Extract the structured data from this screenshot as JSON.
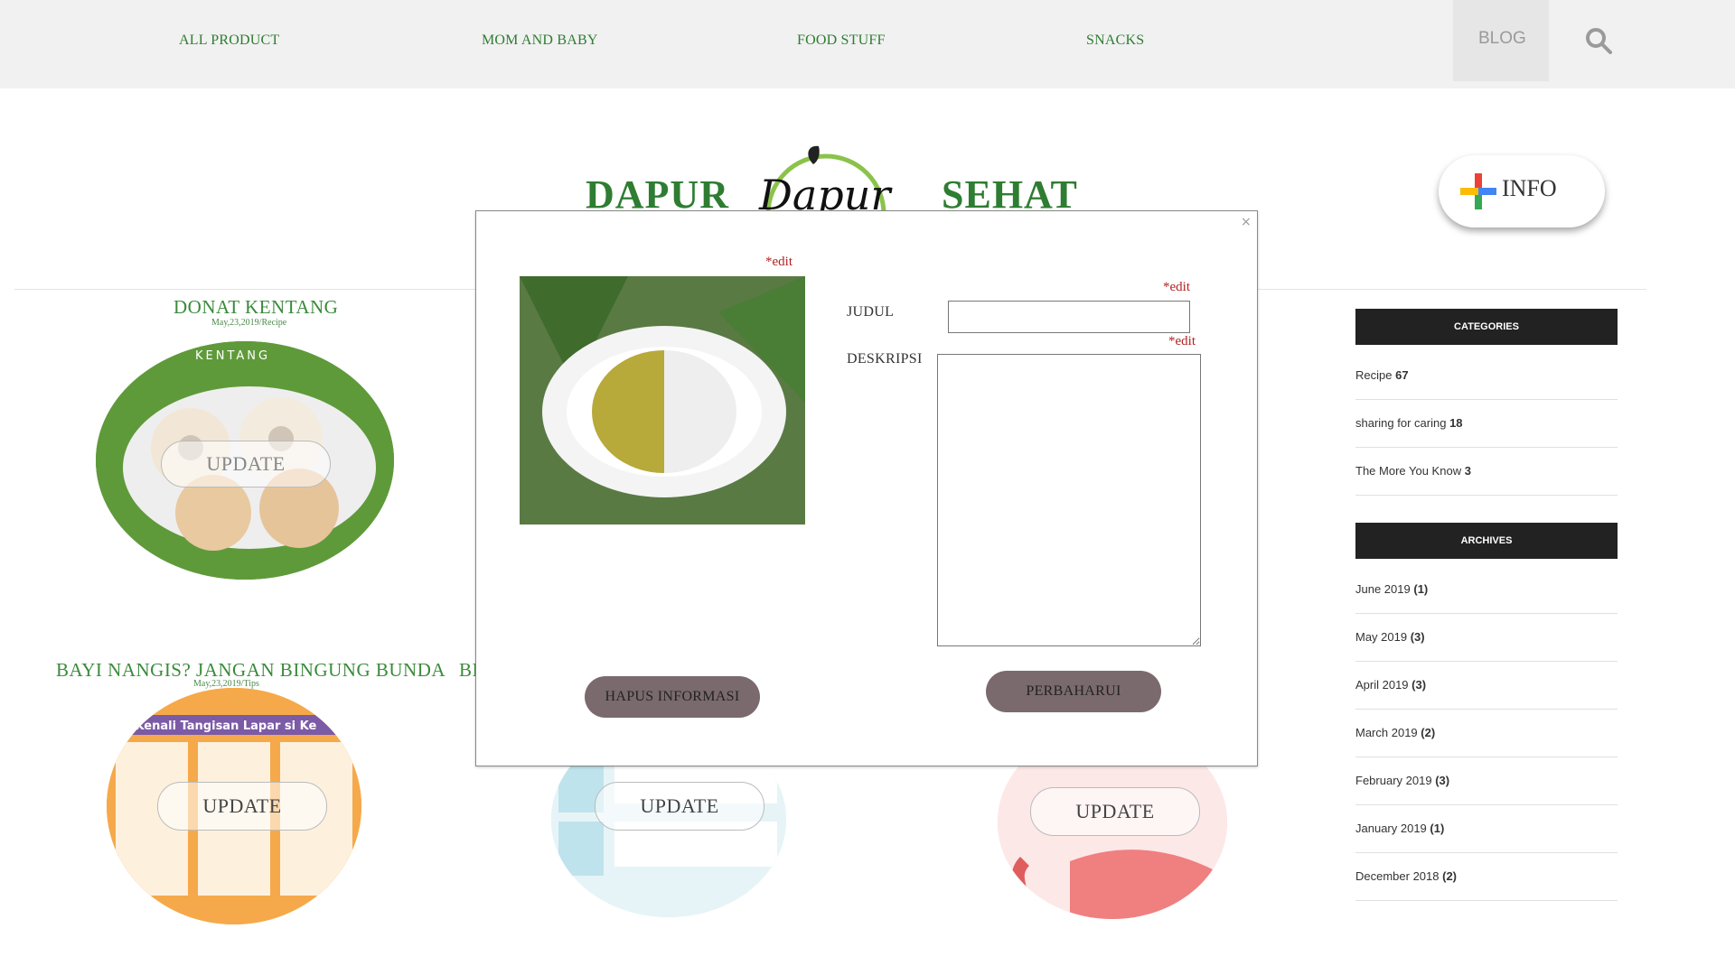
{
  "nav": {
    "items": [
      "ALL PRODUCT",
      "MOM AND BABY",
      "FOOD STUFF",
      "SNACKS"
    ],
    "blog": "BLOG"
  },
  "brand": {
    "left": "DAPUR",
    "right": "SEHAT",
    "logo_text": "Dapur"
  },
  "info_button": {
    "label": "INFO"
  },
  "posts": [
    {
      "title": "DONAT KENTANG",
      "meta": "May,23,2019/Recipe",
      "overlay": "KENTANG",
      "update": "UPDATE"
    },
    {
      "title": "BAYI NANGIS? JANGAN BINGUNG BUNDA",
      "meta": "May,23,2019/Tips",
      "overlay": ", Kenali Tangisan Lapar si Ke",
      "update": "UPDATE"
    },
    {
      "title": "BI",
      "update": "UPDATE"
    },
    {
      "update": "UPDATE"
    }
  ],
  "sidebar": {
    "categories_title": "CATEGORIES",
    "categories": [
      {
        "name": "Recipe",
        "count": "67"
      },
      {
        "name": "sharing for caring",
        "count": "18"
      },
      {
        "name": "The More You Know",
        "count": "3"
      }
    ],
    "archives_title": "ARCHIVES",
    "archives": [
      {
        "name": "June 2019",
        "count": "(1)"
      },
      {
        "name": "May 2019",
        "count": "(3)"
      },
      {
        "name": "April 2019",
        "count": "(3)"
      },
      {
        "name": "March 2019",
        "count": "(2)"
      },
      {
        "name": "February 2019",
        "count": "(3)"
      },
      {
        "name": "January 2019",
        "count": "(1)"
      },
      {
        "name": "December 2018",
        "count": "(2)"
      }
    ]
  },
  "modal": {
    "close": "×",
    "edit_tag": "*edit",
    "judul_label": "JUDUL",
    "deskripsi_label": "DESKRIPSI",
    "judul_value": "",
    "deskripsi_value": "",
    "delete_button": "HAPUS INFORMASI",
    "update_button": "PERBAHARUI"
  }
}
